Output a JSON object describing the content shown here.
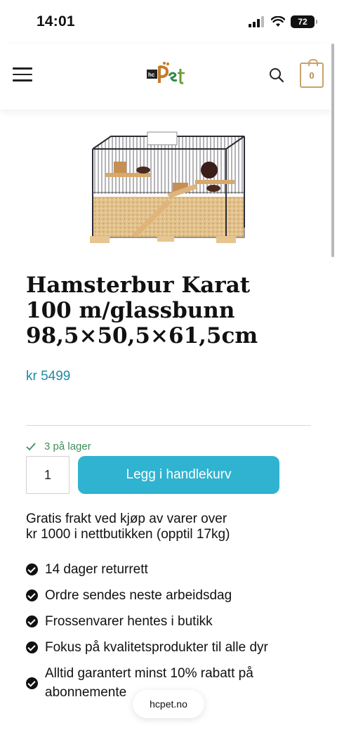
{
  "status_bar": {
    "time": "14:01",
    "battery": "72"
  },
  "header": {
    "logo_text": "hcPet",
    "cart_count": "0"
  },
  "product": {
    "title_lines": [
      "Hamsterbur Karat",
      "100 m/glassbunn",
      "98,5×50,5×61,5cm"
    ],
    "price": "kr 5499",
    "stock": "3 på lager",
    "quantity": "1",
    "add_to_cart_label": "Legg i handlekurv"
  },
  "shipping_lines": [
    "Gratis frakt ved kjøp av varer over",
    "kr 1000 i nettbutikken (opptil 17kg)"
  ],
  "features": [
    "14 dager returrett",
    "Ordre sendes neste arbeidsdag",
    "Frossenvarer hentes i butikk",
    "Fokus på kvalitetsprodukter til alle dyr",
    "Alltid garantert minst 10% rabatt på",
    "abonnemente"
  ],
  "browser": {
    "url": "hcpet.no"
  },
  "colors": {
    "accent": "#2fb3d1",
    "price": "#1e8ba3",
    "stock": "#3e8e5b",
    "cart_border": "#c8a36a"
  }
}
